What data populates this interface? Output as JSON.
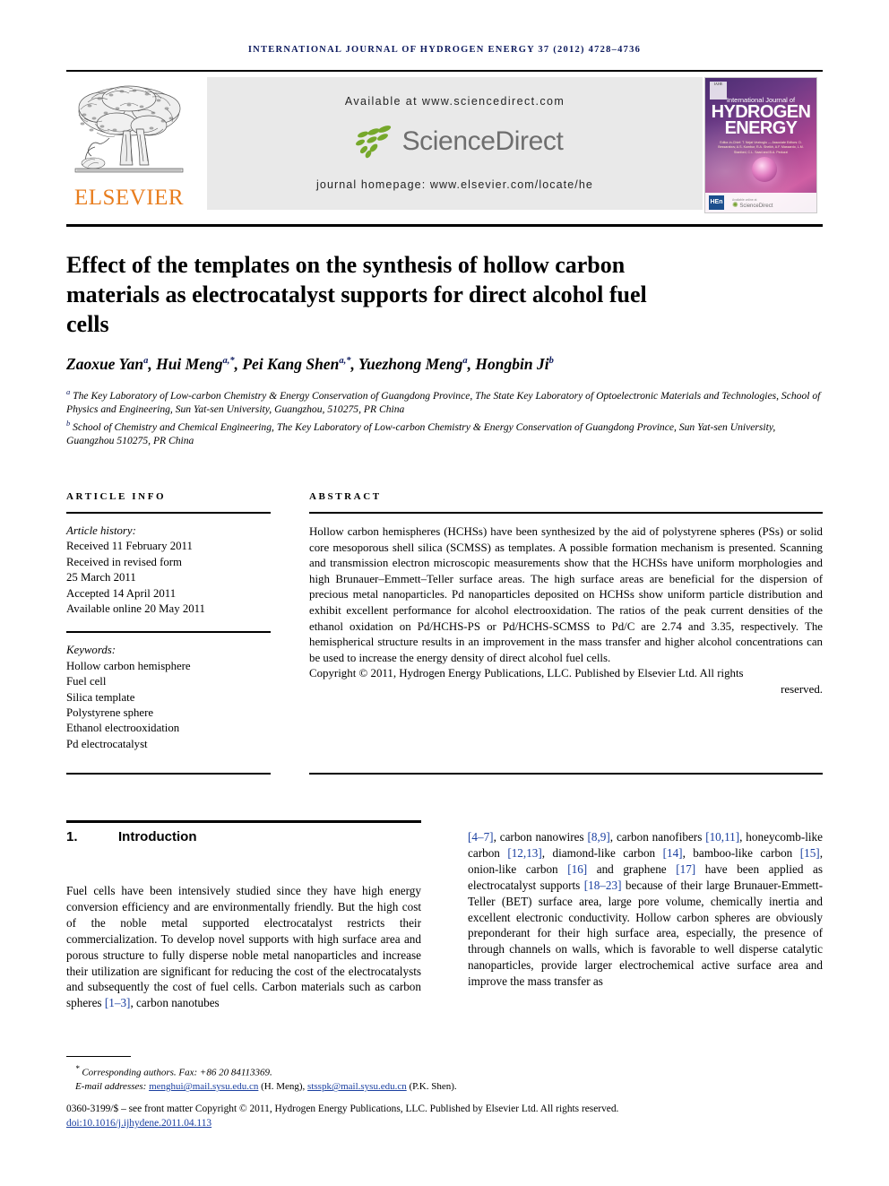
{
  "running_head": "International Journal of Hydrogen Energy 37 (2012) 4728–4736",
  "masthead": {
    "publisher_name": "ELSEVIER",
    "available_at": "Available at www.sciencedirect.com",
    "sciencedirect_word": "ScienceDirect",
    "journal_homepage": "journal homepage: www.elsevier.com/locate/he",
    "cover": {
      "line_top": "International Journal of",
      "line_h": "HYDROGEN",
      "line_e": "ENERGY",
      "editors": "Editor-in-Chief: T. Nejat Veziroglu — Associate Editors: D. Bessarabov, A.S. Kumbur, R.A. Sheikh, A.F. Massardo, L.M. Stanford, C.L. Saad and B.A. Peduzzi",
      "badge_text": "IAHE",
      "hen_badge": "HEn",
      "sd_small": "Available online at",
      "sd_name": "ScienceDirect"
    }
  },
  "article": {
    "title": "Effect of the templates on the synthesis of hollow carbon materials as electrocatalyst supports for direct alcohol fuel cells",
    "authors": "Zaoxue Yan a, Hui Meng a,*, Pei Kang Shen a,*, Yuezhong Meng a, Hongbin Ji b",
    "affiliation_a": "a The Key Laboratory of Low-carbon Chemistry & Energy Conservation of Guangdong Province, The State Key Laboratory of Optoelectronic Materials and Technologies, School of Physics and Engineering, Sun Yat-sen University, Guangzhou, 510275, PR China",
    "affiliation_b": "b School of Chemistry and Chemical Engineering, The Key Laboratory of Low-carbon Chemistry & Energy Conservation of Guangdong Province, Sun Yat-sen University, Guangzhou 510275, PR China"
  },
  "article_info": {
    "heading": "ARTICLE INFO",
    "history_label": "Article history:",
    "history": [
      "Received 11 February 2011",
      "Received in revised form",
      "25 March 2011",
      "Accepted 14 April 2011",
      "Available online 20 May 2011"
    ],
    "keywords_label": "Keywords:",
    "keywords": [
      "Hollow carbon hemisphere",
      "Fuel cell",
      "Silica template",
      "Polystyrene sphere",
      "Ethanol electrooxidation",
      "Pd electrocatalyst"
    ]
  },
  "abstract": {
    "heading": "ABSTRACT",
    "body": "Hollow carbon hemispheres (HCHSs) have been synthesized by the aid of polystyrene spheres (PSs) or solid core mesoporous shell silica (SCMSS) as templates. A possible formation mechanism is presented. Scanning and transmission electron microscopic measurements show that the HCHSs have uniform morphologies and high Brunauer–Emmett–Teller surface areas. The high surface areas are beneficial for the dispersion of precious metal nanoparticles. Pd nanoparticles deposited on HCHSs show uniform particle distribution and exhibit excellent performance for alcohol electrooxidation. The ratios of the peak current densities of the ethanol oxidation on Pd/HCHS-PS or Pd/HCHS-SCMSS to Pd/C are 2.74 and 3.35, respectively. The hemispherical structure results in an improvement in the mass transfer and higher alcohol concentrations can be used to increase the energy density of direct alcohol fuel cells.",
    "copyright_lead": "Copyright © 2011, Hydrogen Energy Publications, LLC. Published by Elsevier Ltd. All rights",
    "copyright_tail": "reserved."
  },
  "introduction": {
    "number": "1.",
    "heading": "Introduction",
    "left_p1": "Fuel cells have been intensively studied since they have high energy conversion efficiency and are environmentally friendly. But the high cost of the noble metal supported electrocatalyst restricts their commercialization. To develop novel supports with high surface area and porous structure to fully disperse noble metal nanoparticles and increase their utilization are significant for reducing the cost of the electrocatalysts and subsequently the cost of fuel cells. Carbon materials such as carbon spheres ",
    "cite_1_3": "[1–3]",
    "left_p1_tail": ", carbon nanotubes",
    "right_c1": "[4–7]",
    "right_t1": ", carbon nanowires ",
    "right_c2": "[8,9]",
    "right_t2": ", carbon nanofibers ",
    "right_c3": "[10,11]",
    "right_t3": ", honeycomb-like carbon ",
    "right_c4": "[12,13]",
    "right_t4": ", diamond-like carbon ",
    "right_c5": "[14]",
    "right_t5": ", bamboo-like carbon ",
    "right_c6": "[15]",
    "right_t6": ", onion-like carbon ",
    "right_c7": "[16]",
    "right_t7": " and graphene ",
    "right_c8": "[17]",
    "right_t8": " have been applied as electrocatalyst supports ",
    "right_c9": "[18–23]",
    "right_t9": " because of their large Brunauer-Emmett-Teller (BET) surface area, large pore volume, chemically inertia and excellent electronic conductivity. Hollow carbon spheres are obviously preponderant for their high surface area, especially, the presence of through channels on walls, which is favorable to well disperse catalytic nanoparticles, provide larger electrochemical active surface area and improve the mass transfer as"
  },
  "footer": {
    "corresponding_marker": "*",
    "corresponding": "Corresponding authors. Fax: +86 20 84113369.",
    "email_label": "E-mail addresses:",
    "email_1": "menghui@mail.sysu.edu.cn",
    "email_1_owner": "(H. Meng),",
    "email_2": "stsspk@mail.sysu.edu.cn",
    "email_2_owner": "(P.K. Shen).",
    "issn_line": "0360-3199/$ – see front matter Copyright © 2011, Hydrogen Energy Publications, LLC. Published by Elsevier Ltd. All rights reserved.",
    "doi": "doi:10.1016/j.ijhydene.2011.04.113"
  }
}
